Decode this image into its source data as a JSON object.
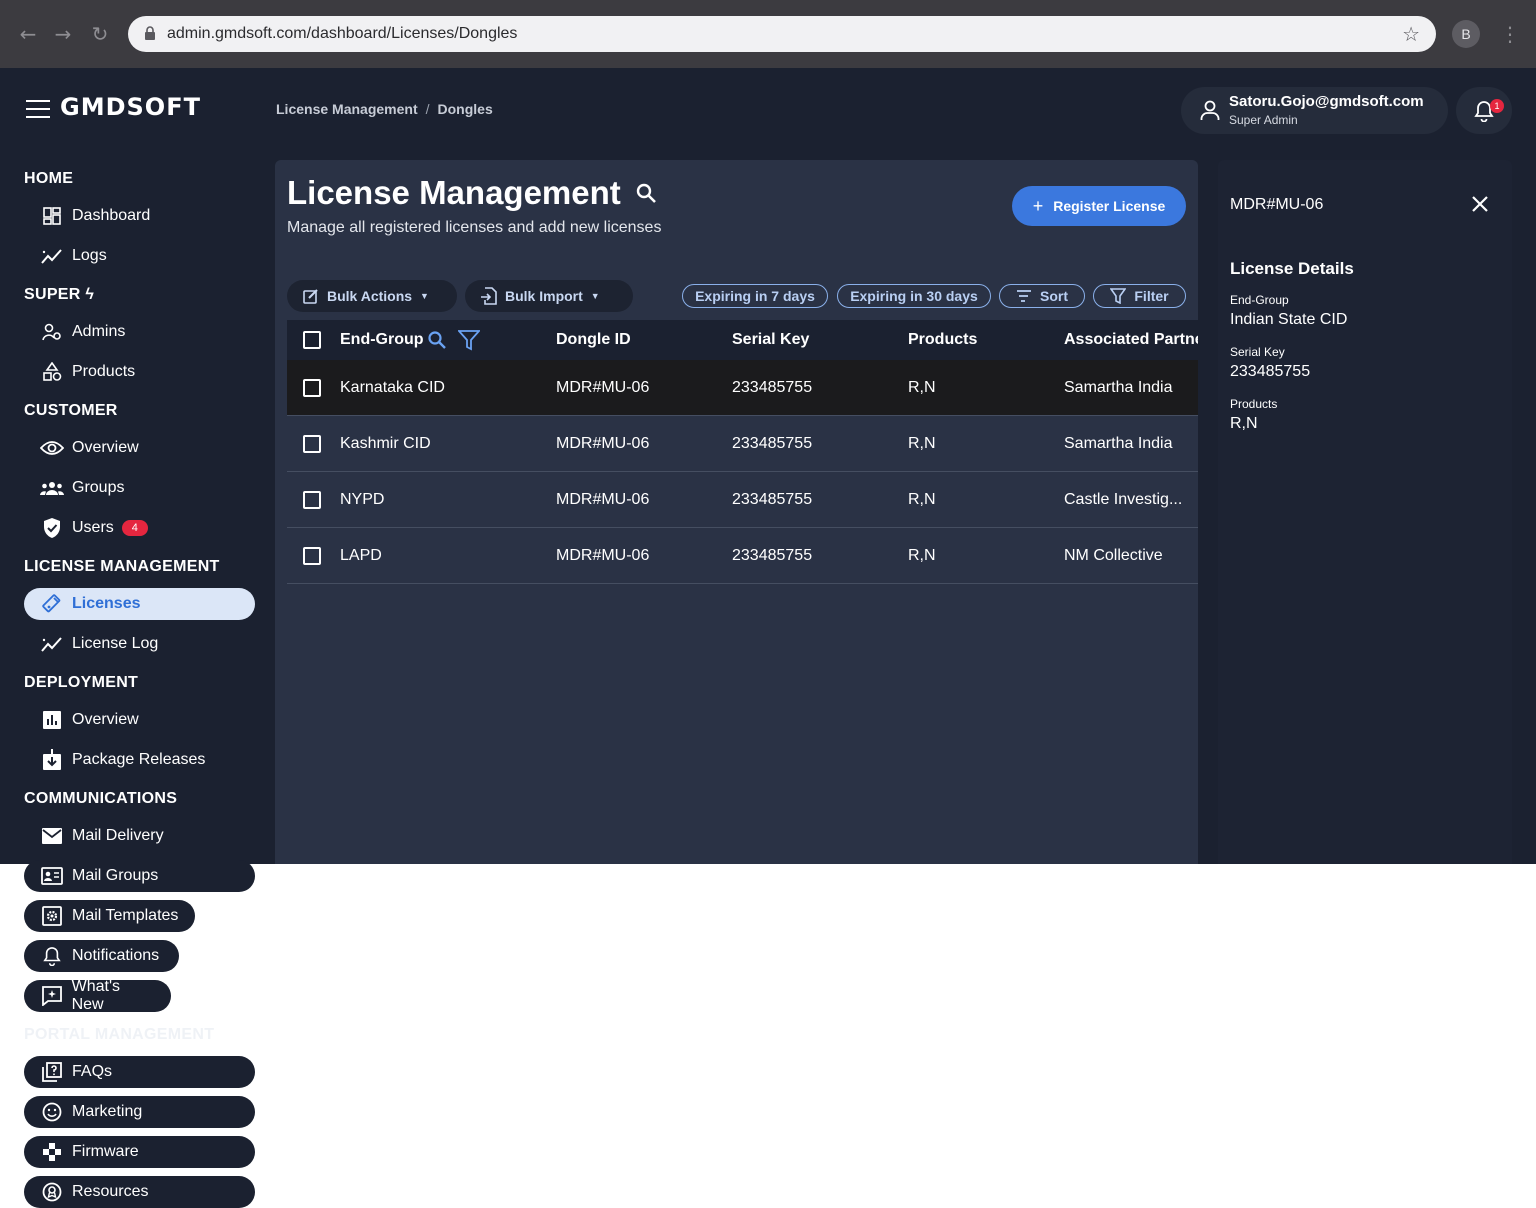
{
  "browser": {
    "url": "admin.gmdsoft.com/dashboard/Licenses/Dongles",
    "profile_initial": "B"
  },
  "header": {
    "logo": "GMDSOFT",
    "breadcrumb": [
      "License Management",
      "Dongles"
    ],
    "breadcrumb_sep": "/",
    "user_email": "Satoru.Gojo@gmdsoft.com",
    "user_role": "Super Admin",
    "notification_count": "1"
  },
  "sidebar": {
    "sections": {
      "home": "HOME",
      "super": "SUPER",
      "customer": "CUSTOMER",
      "license": "LICENSE MANAGEMENT",
      "deployment": "DEPLOYMENT",
      "communications": "COMMUNICATIONS",
      "portal": "PORTAL MANAGEMENT"
    },
    "items": {
      "dashboard": "Dashboard",
      "logs": "Logs",
      "admins": "Admins",
      "products": "Products",
      "overview": "Overview",
      "groups": "Groups",
      "users": "Users",
      "users_badge": "4",
      "licenses": "Licenses",
      "license_log": "License Log",
      "deploy_overview": "Overview",
      "package_releases": "Package Releases",
      "mail_delivery": "Mail Delivery",
      "mail_groups": "Mail Groups",
      "mail_templates": "Mail Templates",
      "notifications": "Notifications",
      "whats_new": "What's New",
      "faqs": "FAQs",
      "marketing": "Marketing",
      "firmware": "Firmware",
      "resources": "Resources"
    }
  },
  "main": {
    "title": "License Management",
    "subtitle": "Manage all registered licenses and add new licenses",
    "register_label": "Register License",
    "bulk_actions": "Bulk Actions",
    "bulk_import": "Bulk Import",
    "chip_7": "Expiring in 7 days",
    "chip_30": "Expiring in 30 days",
    "sort": "Sort",
    "filter": "Filter",
    "columns": [
      "End-Group",
      "Dongle ID",
      "Serial Key",
      "Products",
      "Associated Partner"
    ],
    "rows": [
      {
        "end_group": "Karnataka CID",
        "dongle_id": "MDR#MU-06",
        "serial": "233485755",
        "products": "R,N",
        "partner": "Samartha India"
      },
      {
        "end_group": "Kashmir CID",
        "dongle_id": "MDR#MU-06",
        "serial": "233485755",
        "products": "R,N",
        "partner": "Samartha India"
      },
      {
        "end_group": "NYPD",
        "dongle_id": "MDR#MU-06",
        "serial": "233485755",
        "products": "R,N",
        "partner": "Castle Investig..."
      },
      {
        "end_group": "LAPD",
        "dongle_id": "MDR#MU-06",
        "serial": "233485755",
        "products": "R,N",
        "partner": "NM Collective"
      }
    ]
  },
  "panel": {
    "id": "MDR#MU-06",
    "heading": "License Details",
    "end_group_label": "End-Group",
    "end_group_value": "Indian State CID",
    "serial_label": "Serial Key",
    "serial_value": "233485755",
    "products_label": "Products",
    "products_value": "R,N"
  },
  "colors": {
    "app_bg": "#1b2130",
    "content_bg": "#2a3245",
    "accent": "#3b78de",
    "badge": "#e5263f"
  }
}
